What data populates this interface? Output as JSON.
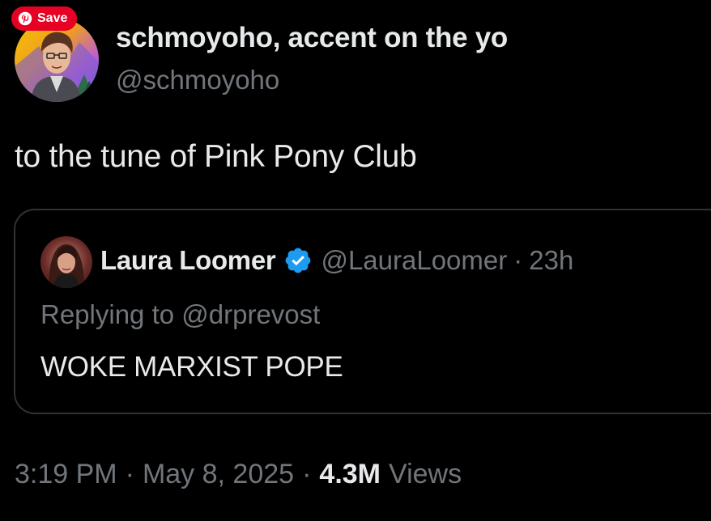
{
  "pinterest": {
    "save_label": "Save",
    "accent": "#e60023"
  },
  "author": {
    "display_name": "schmoyoho, accent on the yo",
    "handle": "@schmoyoho"
  },
  "tweet": {
    "text": "to the tune of Pink Pony Club"
  },
  "quoted_tweet": {
    "display_name": "Laura Loomer",
    "verified_icon": "verified-badge-icon",
    "verified_color": "#1d9bf0",
    "handle": "@LauraLoomer",
    "separator": "·",
    "time": "23h",
    "replying_to": "Replying to @drprevost",
    "text": "WOKE MARXIST POPE"
  },
  "meta": {
    "time": "3:19 PM",
    "separator": "·",
    "date": "May 8, 2025",
    "views_count": "4.3M",
    "views_label": "Views"
  },
  "colors": {
    "background": "#000000",
    "primary_text": "#e7e9ea",
    "secondary_text": "#71767b",
    "border": "#2f3336"
  }
}
